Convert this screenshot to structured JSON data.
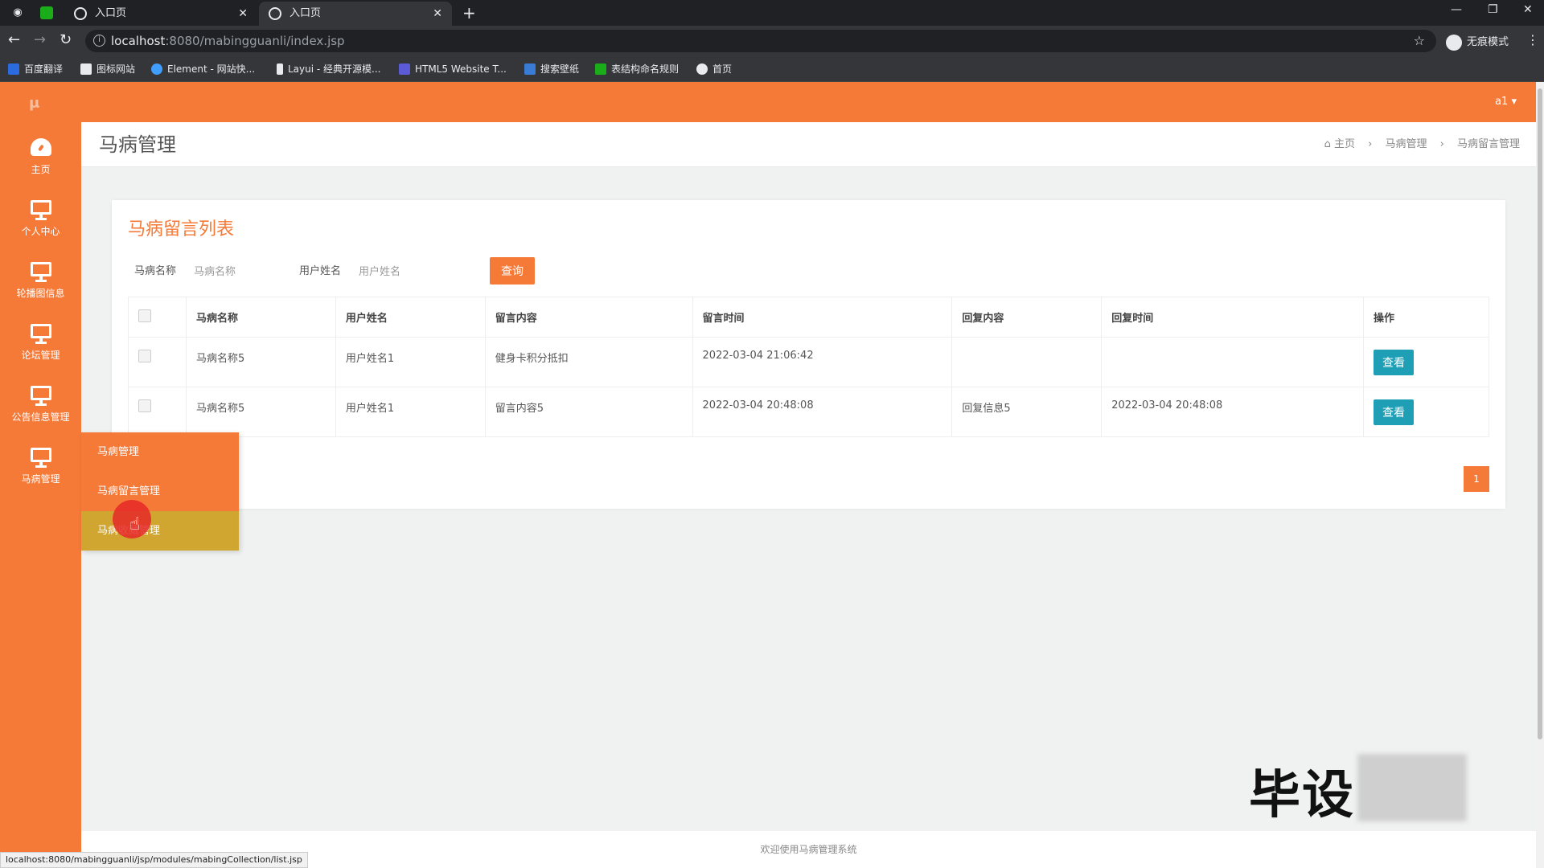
{
  "browser": {
    "tabs": [
      {
        "label": "入口页"
      },
      {
        "label": "入口页"
      }
    ],
    "url_host": "localhost",
    "url_rest": ":8080/mabingguanli/index.jsp",
    "incognito_label": "无痕模式",
    "bookmarks": [
      {
        "label": "百度翻译",
        "color": "#2a6ce0"
      },
      {
        "label": "图标网站",
        "color": "#e8eaed"
      },
      {
        "label": "Element - 网站快...",
        "color": "#409eff"
      },
      {
        "label": "Layui - 经典开源模...",
        "color": "#e8eaed"
      },
      {
        "label": "HTML5 Website T...",
        "color": "#5b5bd6"
      },
      {
        "label": "搜索壁纸",
        "color": "#3a7bd5"
      },
      {
        "label": "表结构命名规则",
        "color": "#1aad19"
      },
      {
        "label": "首页",
        "color": "#e8eaed"
      }
    ],
    "status_url": "localhost:8080/mabingguanli/jsp/modules/mabingCollection/list.jsp"
  },
  "header": {
    "user": "a1 ▾",
    "brand_color": "#f57a38"
  },
  "sidebar": {
    "items": [
      {
        "label": "主页",
        "icon": "dashboard-icon"
      },
      {
        "label": "个人中心",
        "icon": "monitor-icon"
      },
      {
        "label": "轮播图信息",
        "icon": "monitor-icon"
      },
      {
        "label": "论坛管理",
        "icon": "monitor-icon"
      },
      {
        "label": "公告信息管理",
        "icon": "monitor-icon"
      },
      {
        "label": "马病管理",
        "icon": "monitor-icon"
      }
    ],
    "submenu": [
      {
        "label": "马病管理"
      },
      {
        "label": "马病留言管理"
      },
      {
        "label": "马病收藏管理"
      }
    ]
  },
  "page": {
    "title": "马病管理",
    "breadcrumb": [
      "主页",
      "马病管理",
      "马病留言管理"
    ]
  },
  "card": {
    "title": "马病留言列表",
    "filters": {
      "name_label": "马病名称",
      "name_placeholder": "马病名称",
      "user_label": "用户姓名",
      "user_placeholder": "用户姓名",
      "search_button": "查询"
    },
    "columns": [
      "马病名称",
      "用户姓名",
      "留言内容",
      "留言时间",
      "回复内容",
      "回复时间",
      "操作"
    ],
    "rows": [
      {
        "name": "马病名称5",
        "user": "用户姓名1",
        "content": "健身卡积分抵扣",
        "time": "2022-03-04 21:06:42",
        "reply": "",
        "reply_time": "",
        "action": "查看"
      },
      {
        "name": "马病名称5",
        "user": "用户姓名1",
        "content": "留言内容5",
        "time": "2022-03-04 20:48:08",
        "reply": "回复信息5",
        "reply_time": "2022-03-04 20:48:08",
        "action": "查看"
      }
    ],
    "page_number": "1"
  },
  "footer": {
    "text": "欢迎使用马病管理系统"
  },
  "watermark": "毕设"
}
